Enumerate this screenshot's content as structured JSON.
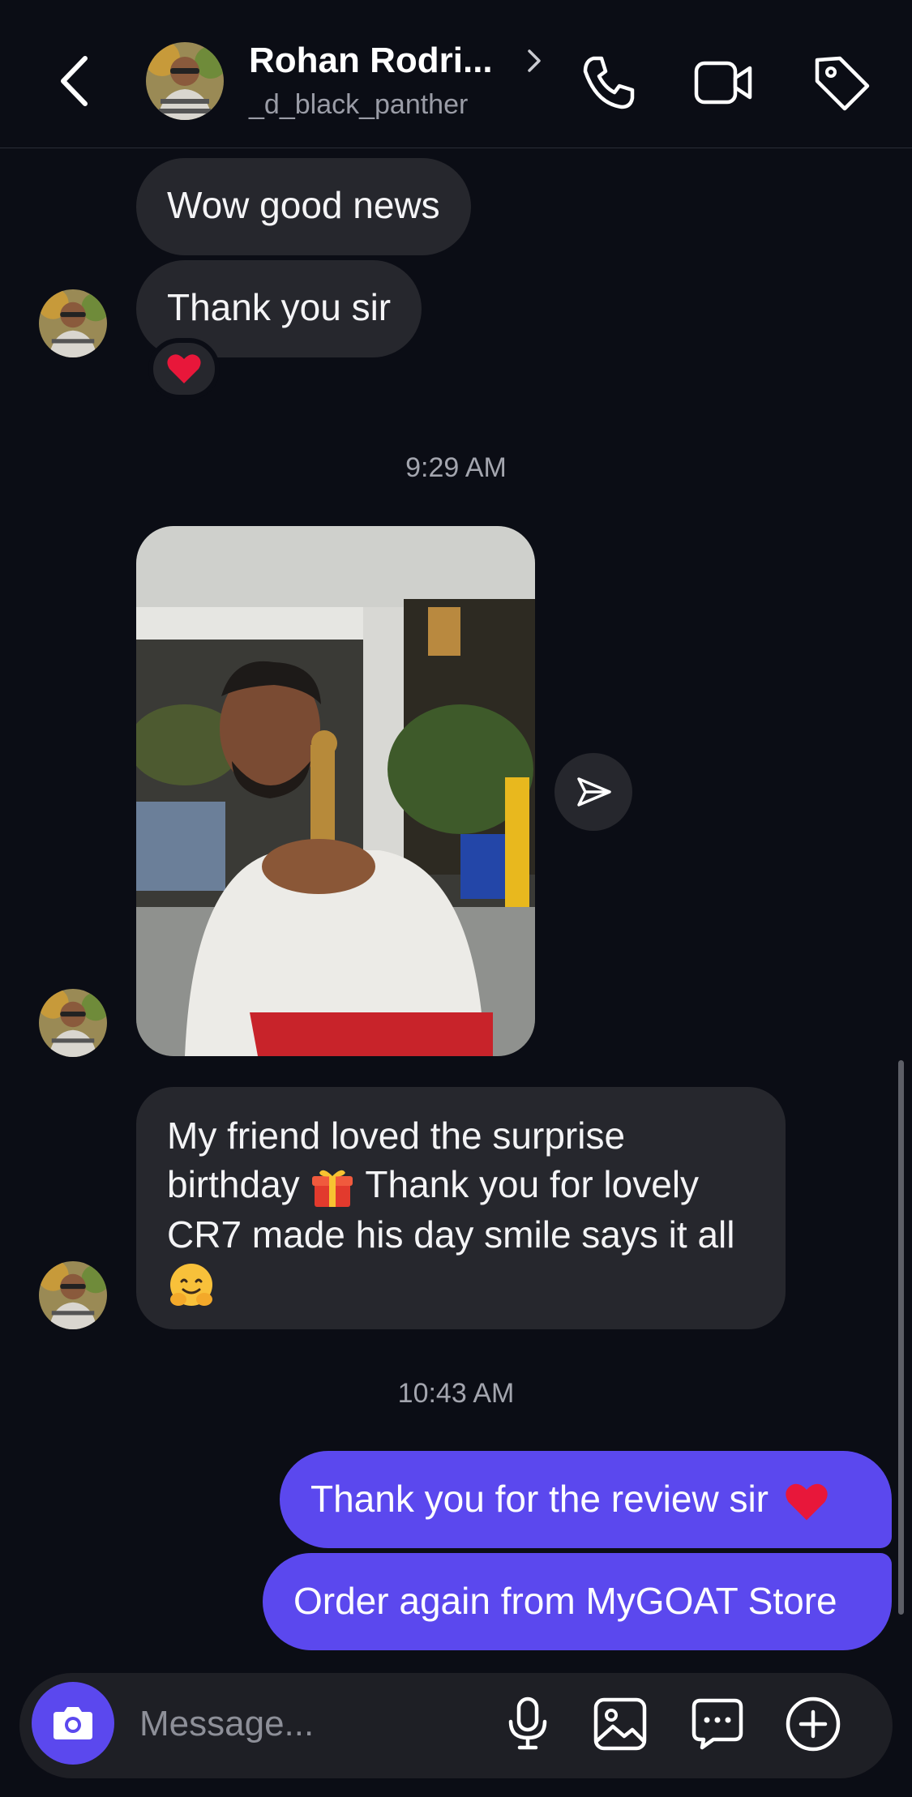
{
  "header": {
    "contact_name": "Rohan Rodri...",
    "username": "_d_black_panther",
    "icons": [
      "back-icon",
      "chevron-right-icon",
      "phone-icon",
      "video-icon",
      "tag-icon"
    ]
  },
  "messages": {
    "m1": "Wow good news",
    "m2": "Thank you sir",
    "m2_reaction": "heart",
    "time1": "9:29 AM",
    "m4_line1": "My friend loved the surprise",
    "m4_line2a": "birthday",
    "m4_line2b": "Thank you for lovely",
    "m4_line3": "CR7 made his day smile says it all",
    "m4_emojis": [
      "gift",
      "hugging-face"
    ],
    "time2": "10:43 AM",
    "out1": "Thank you for the review sir",
    "out2": "Order again from MyGOAT Store"
  },
  "composer": {
    "placeholder": "Message...",
    "icons": [
      "camera-icon",
      "microphone-icon",
      "gallery-icon",
      "sticker-chat-icon",
      "plus-icon"
    ]
  },
  "colors": {
    "background": "#0b0d15",
    "incoming_bubble": "#26272d",
    "outgoing_bubble": "#5b48ee",
    "accent": "#5b48ee"
  }
}
